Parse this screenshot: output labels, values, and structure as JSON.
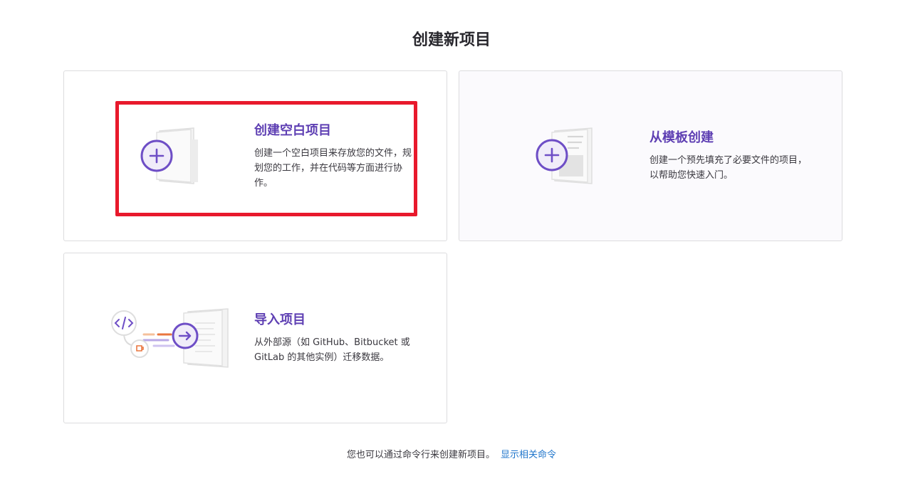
{
  "page": {
    "title": "创建新项目"
  },
  "cards": {
    "blank": {
      "title": "创建空白项目",
      "description": "创建一个空白项目来存放您的文件，规划您的工作，并在代码等方面进行协作。",
      "icon": "plus-document-icon"
    },
    "template": {
      "title": "从模板创建",
      "description": "创建一个预先填充了必要文件的项目，以帮助您快速入门。",
      "icon": "template-document-icon"
    },
    "import": {
      "title": "导入项目",
      "description": "从外部源（如 GitHub、Bitbucket 或 GitLab 的其他实例）迁移数据。",
      "icon": "import-arrow-icon"
    }
  },
  "footer": {
    "text": "您也可以通过命令行来创建新项目。",
    "link": "显示相关命令"
  },
  "colors": {
    "accent": "#5e3fb3",
    "highlight": "#e8192c",
    "link": "#1f75cb"
  }
}
